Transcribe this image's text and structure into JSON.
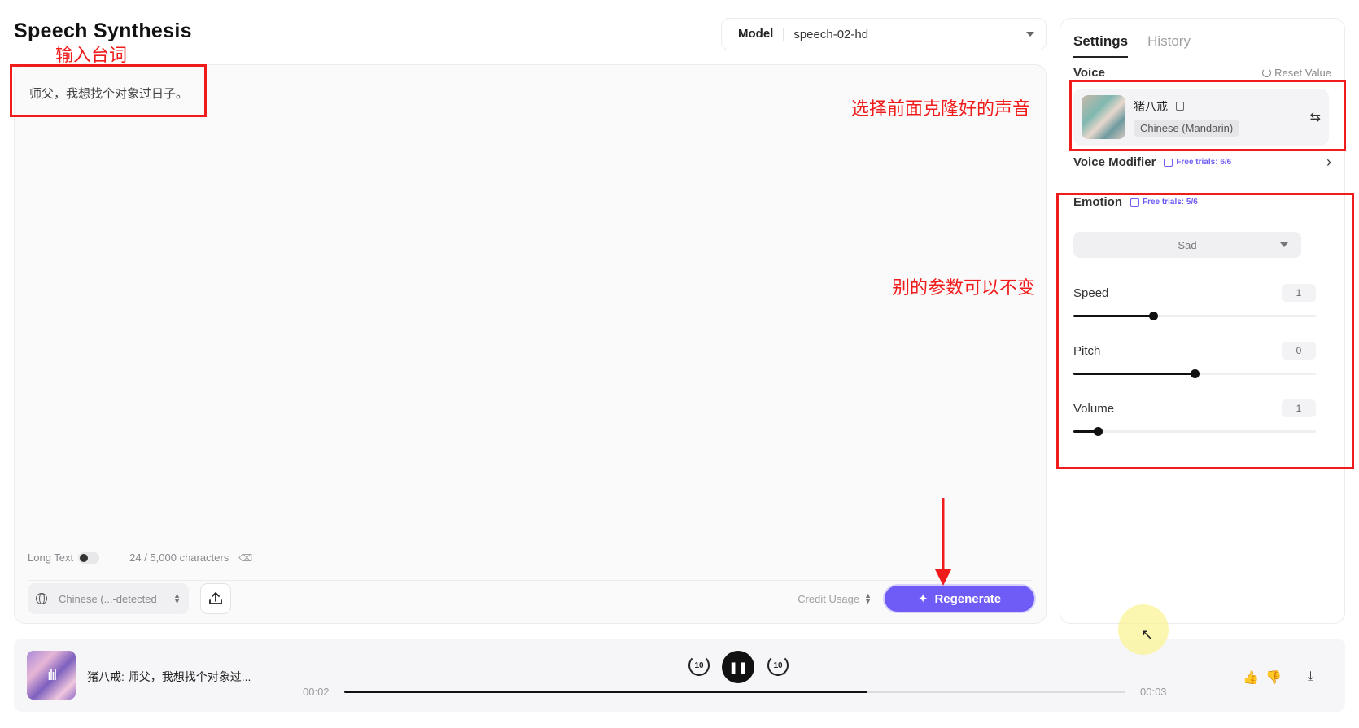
{
  "header": {
    "title": "Speech Synthesis",
    "model_label": "Model",
    "model_value": "speech-02-hd"
  },
  "editor": {
    "text": "师父，我想找个对象过日子。",
    "long_text_label": "Long Text",
    "char_count": "24 / 5,000 characters",
    "language": "Chinese (...-detected",
    "credit_usage": "Credit Usage",
    "regenerate_label": "Regenerate"
  },
  "side": {
    "tabs": [
      {
        "label": "Settings",
        "active": true
      },
      {
        "label": "History",
        "active": false
      }
    ],
    "voice_label": "Voice",
    "reset_label": "Reset Value",
    "voice_name": "猪八戒",
    "voice_lang": "Chinese (Mandarin)",
    "voice_modifier_label": "Voice Modifier",
    "voice_modifier_trials": "Free trials: 6/6",
    "emotion_label": "Emotion",
    "emotion_trials": "Free trials: 5/6",
    "emotion_value": "Sad",
    "params": [
      {
        "label": "Speed",
        "value": "1",
        "level": 0.33
      },
      {
        "label": "Pitch",
        "value": "0",
        "level": 0.5
      },
      {
        "label": "Volume",
        "value": "1",
        "level": 0.1
      }
    ]
  },
  "annotations": {
    "input_lines": "输入台词",
    "choose_voice": "选择前面克隆好的声音",
    "other_params": "别的参数可以不变"
  },
  "player": {
    "track_title": "猪八戒: 师父，我想找个对象过...",
    "current_time": "00:02",
    "total_time": "00:03",
    "progress": 0.67,
    "skip_back": "10",
    "skip_forward": "10"
  }
}
